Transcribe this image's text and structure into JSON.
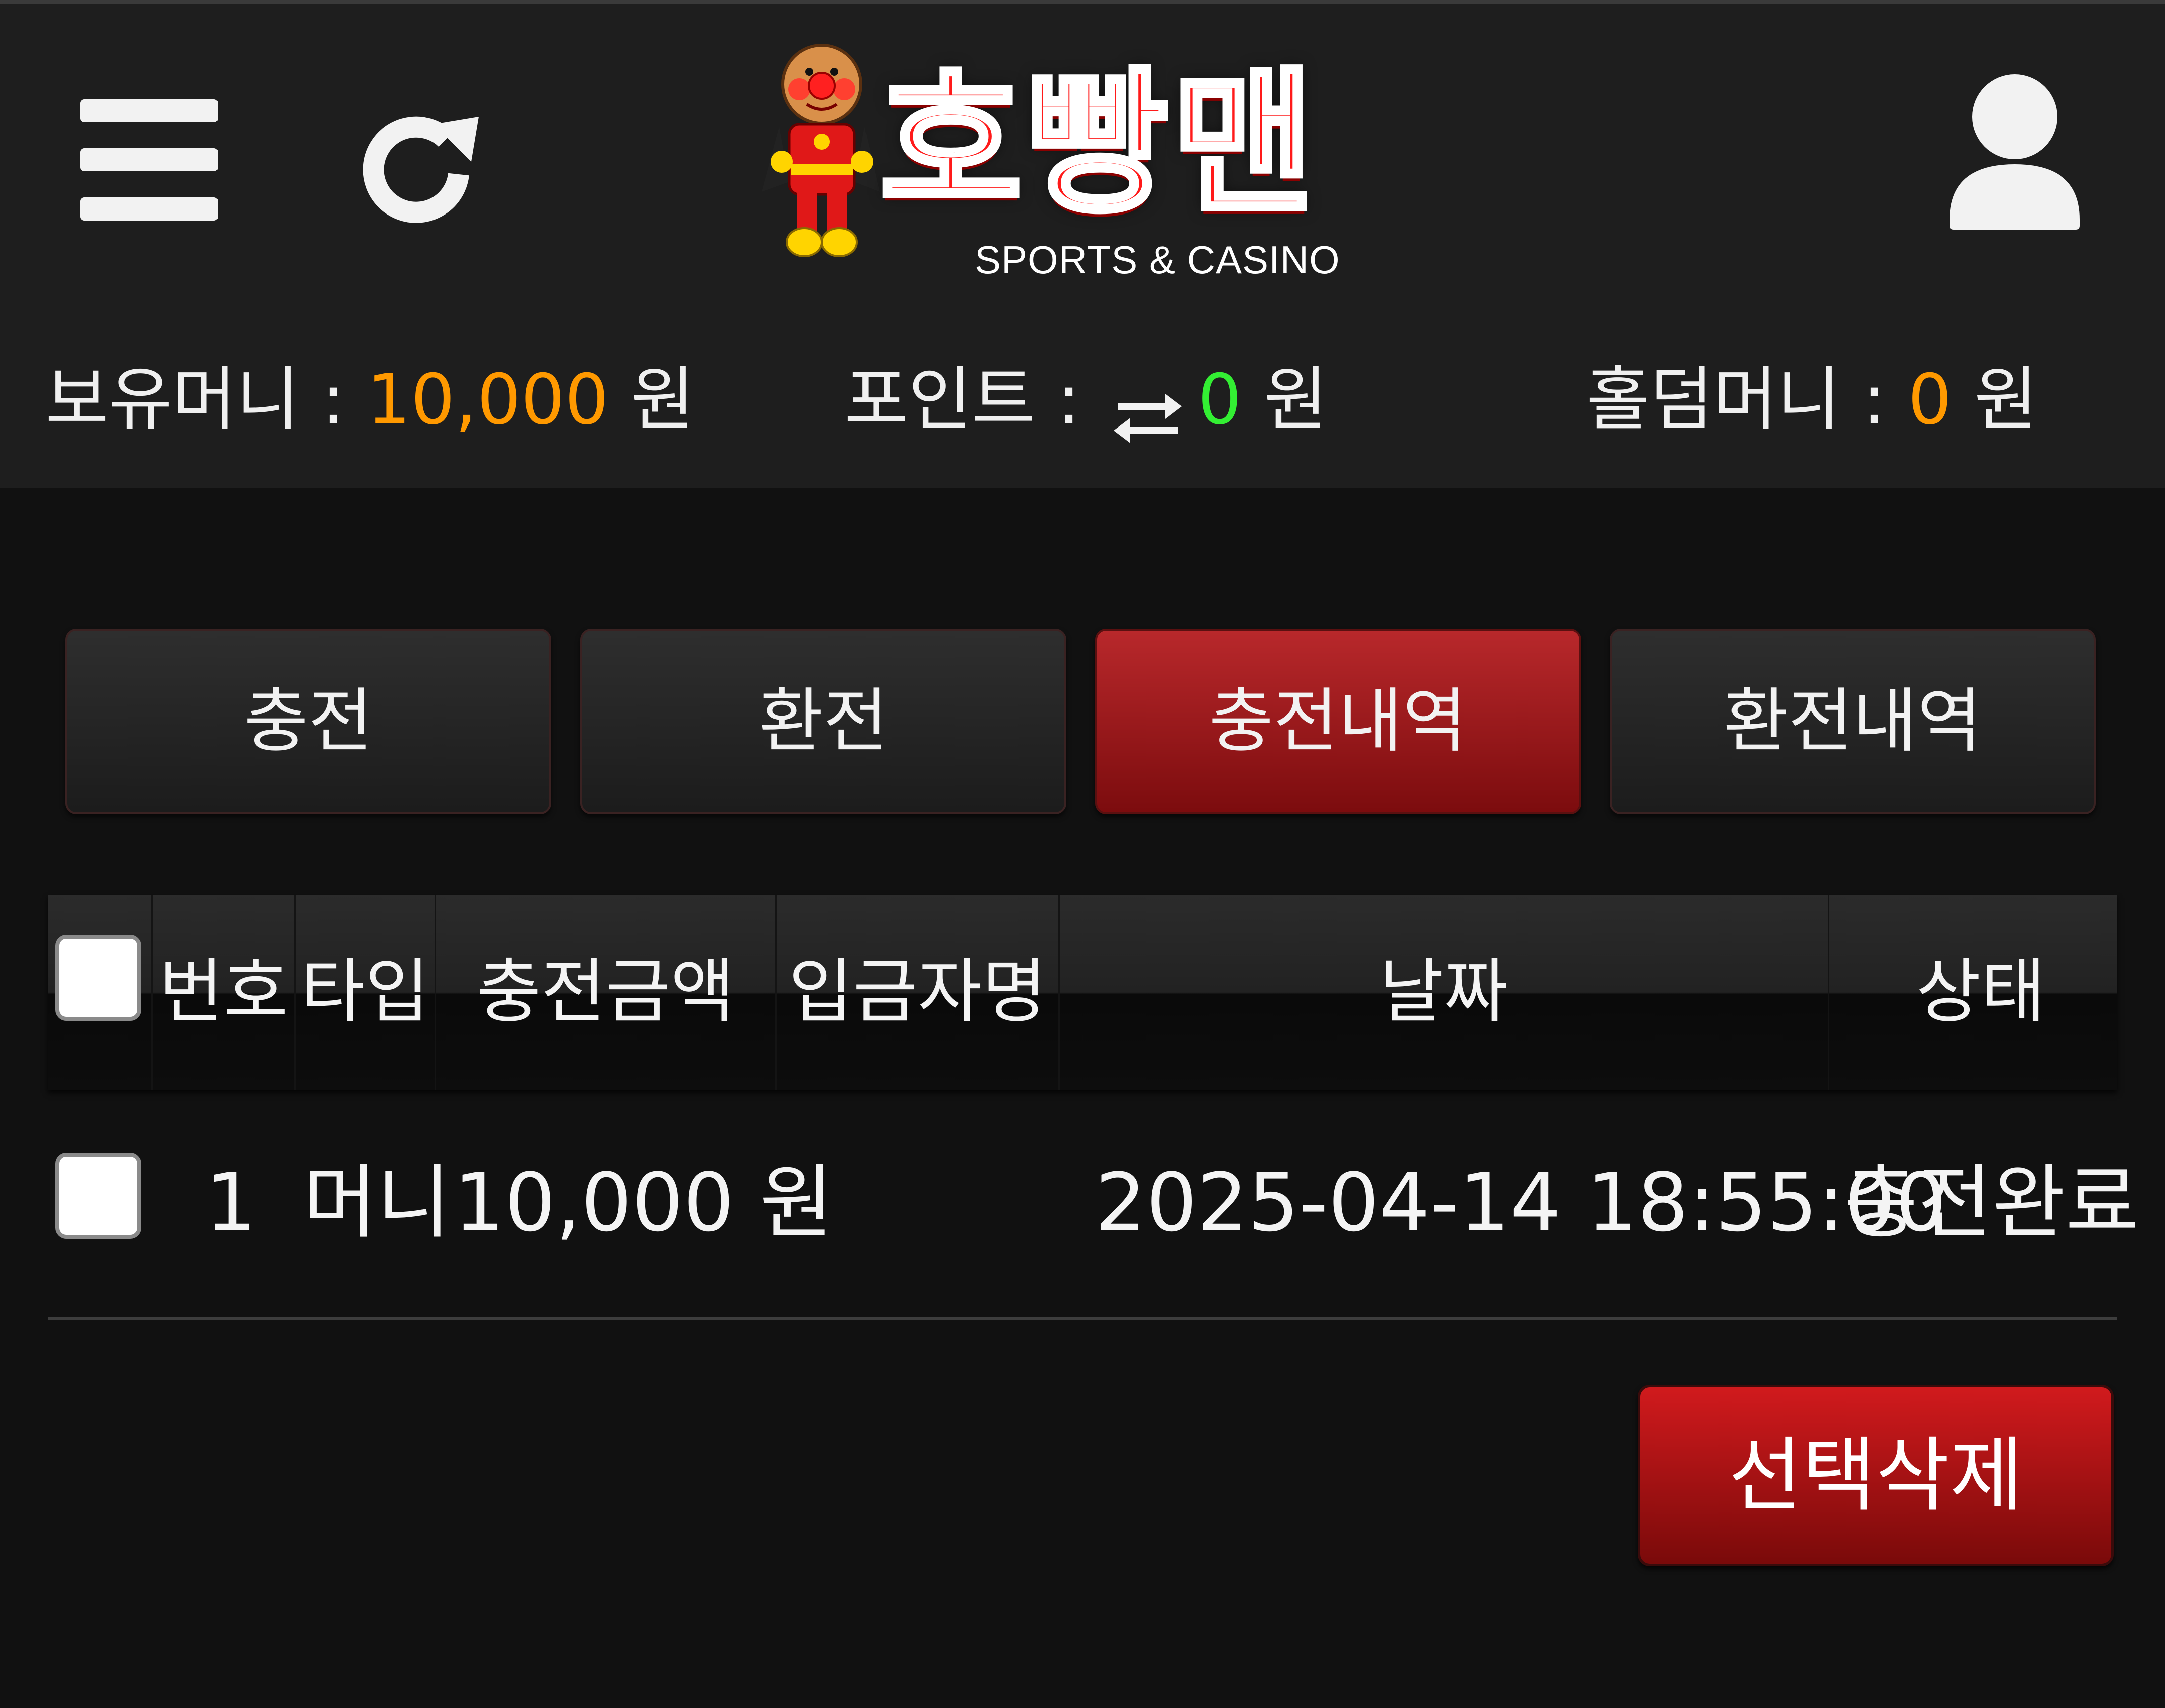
{
  "header": {
    "logo_title": "호빵맨",
    "logo_subtitle": "SPORTS & CASINO",
    "menu_icon": "hamburger-menu-icon",
    "refresh_icon": "refresh-icon",
    "user_icon": "user-icon"
  },
  "balances": {
    "money_label": "보유머니 : ",
    "money_value": "10,000",
    "money_unit": " 원",
    "point_label": "포인트 : ",
    "point_value": "0",
    "point_unit": " 원",
    "holdem_label": "홀덤머니 : ",
    "holdem_value": "0",
    "holdem_unit": " 원"
  },
  "tabs": [
    {
      "label": "충전",
      "active": false
    },
    {
      "label": "환전",
      "active": false
    },
    {
      "label": "충전내역",
      "active": true
    },
    {
      "label": "환전내역",
      "active": false
    }
  ],
  "table": {
    "columns": [
      "번호",
      "타입",
      "충전금액",
      "입금자명",
      "날짜",
      "상태"
    ],
    "rows": [
      {
        "number": "1",
        "type": "머니",
        "amount": "10,000 원",
        "depositor": "",
        "date": "2025-04-14 18:55:00",
        "status": "충전완료"
      }
    ]
  },
  "actions": {
    "delete_selected": "선택삭제"
  },
  "colors": {
    "accent_red": "#b8282b",
    "money_orange": "#ff9900",
    "point_green": "#33ee33",
    "background": "#111111"
  }
}
